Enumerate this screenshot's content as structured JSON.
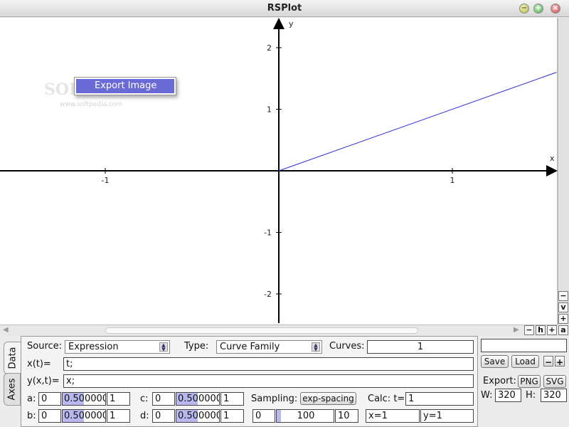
{
  "window": {
    "title": "RSPlot",
    "min_icon": "minimize-icon",
    "max_icon": "maximize-icon",
    "close_icon": "close-icon"
  },
  "plot": {
    "x_axis_label": "x",
    "y_axis_label": "y",
    "x_ticks": [
      "-1",
      "1"
    ],
    "y_ticks": [
      "2",
      "1",
      "-1",
      "-2"
    ],
    "curve_color": "#2a2ad6",
    "x_range": [
      -1.6,
      1.6
    ],
    "y_range": [
      -2.5,
      2.5
    ],
    "curve": {
      "expression": "y = x",
      "x": [
        0,
        1.6
      ],
      "y": [
        0,
        1.6
      ]
    }
  },
  "context_menu": {
    "items": [
      "Export Image"
    ]
  },
  "scroll_buttons": {
    "minus": "−",
    "v": "v",
    "plus": "+",
    "h": "h",
    "a": "a"
  },
  "tabs": [
    "Data",
    "Axes"
  ],
  "data_panel": {
    "source_label": "Source:",
    "source_value": "Expression",
    "type_label": "Type:",
    "type_value": "Curve Family",
    "curves_label": "Curves:",
    "curves_value": "1",
    "xt_label": "x(t)=",
    "xt_value": "t;",
    "yxt_label": "y(x,t)=",
    "yxt_value": "x;",
    "params": [
      {
        "label": "a:",
        "min": "0",
        "value": "0.5000000",
        "max": "1",
        "fraction": 0.5
      },
      {
        "label": "b:",
        "min": "0",
        "value": "0.5000000",
        "max": "1",
        "fraction": 0.5
      },
      {
        "label": "c:",
        "min": "0",
        "value": "0.5000000",
        "max": "1",
        "fraction": 0.5
      },
      {
        "label": "d:",
        "min": "0",
        "value": "0.5000000",
        "max": "1",
        "fraction": 0.5
      }
    ],
    "sampling_label": "Sampling:",
    "sampling_button": "exp-spacing",
    "sampling_min": "0",
    "sampling_value": "100",
    "sampling_max": "10",
    "calc_label": "Calc: t=",
    "calc_value": "1",
    "result_x": "x=1",
    "result_y": "y=1"
  },
  "right_panel": {
    "name_value": "",
    "save_label": "Save",
    "load_label": "Load",
    "minus_label": "−",
    "plus_label": "+",
    "export_label": "Export:",
    "png_label": "PNG",
    "svg_label": "SVG",
    "w_label": "W:",
    "w_value": "320",
    "h_label": "H:",
    "h_value": "320"
  }
}
